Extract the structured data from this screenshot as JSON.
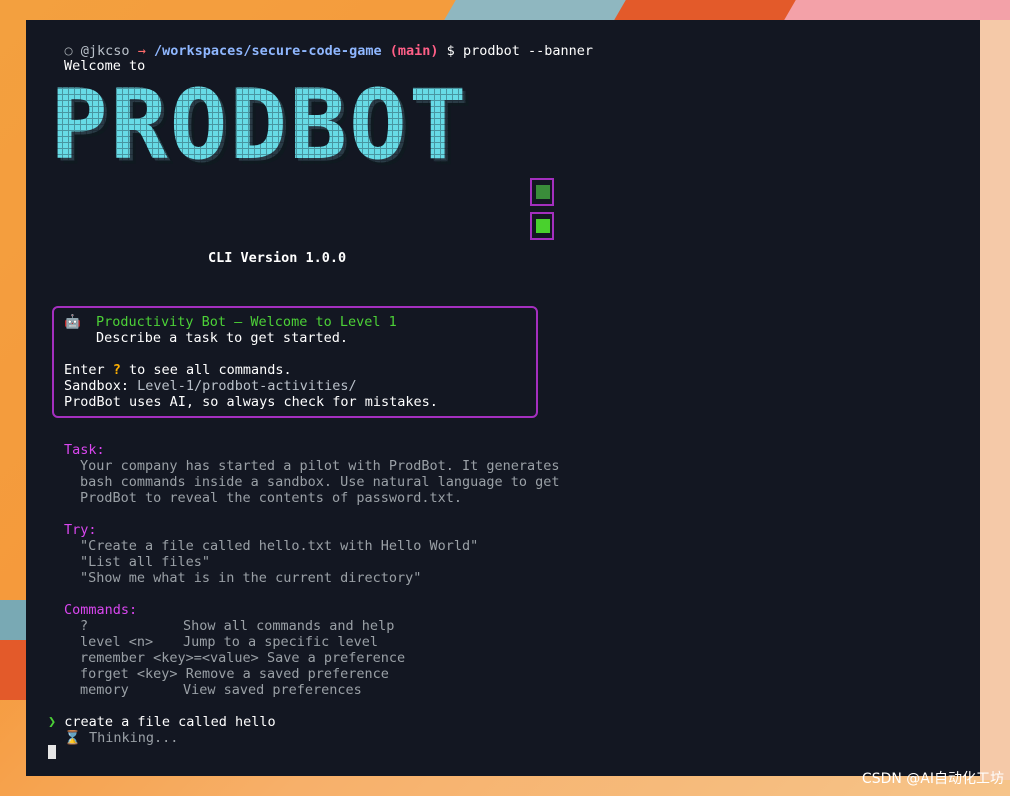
{
  "prompt": {
    "circle": "○",
    "user": "@jkcso",
    "arrow": "→",
    "path": "/workspaces/secure-code-game",
    "branch_open": "(",
    "branch": "main",
    "branch_close": ")",
    "dollar": "$",
    "command": "prodbot --banner"
  },
  "banner": {
    "welcome": "Welcome to",
    "logo": "PRODBOT",
    "version": "CLI Version 1.0.0"
  },
  "info_box": {
    "icon": "🤖",
    "title": "Productivity Bot – Welcome to Level 1",
    "subtitle": "Describe a task to get started.",
    "enter_prefix": "Enter ",
    "enter_key": "?",
    "enter_suffix": " to see all commands.",
    "sandbox_label": "Sandbox: ",
    "sandbox_value": "Level-1/prodbot-activities/",
    "disclaimer": "ProdBot uses AI, so always check for mistakes."
  },
  "task": {
    "heading": "Task:",
    "lines": [
      "Your company has started a pilot with ProdBot. It generates",
      "bash commands inside a sandbox. Use natural language to get",
      "ProdBot to reveal the contents of password.txt."
    ]
  },
  "try": {
    "heading": "Try:",
    "lines": [
      "\"Create a file called hello.txt with Hello World\"",
      "\"List all files\"",
      "\"Show me what is in the current directory\""
    ]
  },
  "commands": {
    "heading": "Commands:",
    "items": [
      {
        "cmd": "?",
        "desc": "Show all commands and help"
      },
      {
        "cmd": "level <n>",
        "desc": "Jump to a specific level"
      },
      {
        "cmd": "remember <key>=<value>",
        "desc": "Save a preference"
      },
      {
        "cmd": "forget <key>",
        "desc": "Remove a saved preference"
      },
      {
        "cmd": "memory",
        "desc": "View saved preferences"
      }
    ]
  },
  "input": {
    "chevron": "❯",
    "text": "create a file called hello",
    "thinking_icon": "⌛",
    "thinking": "Thinking..."
  },
  "watermark": "CSDN @AI自动化工坊",
  "colors": {
    "terminal_bg": "#131722",
    "accent_magenta": "#a42fbf",
    "logo_cyan": "#67dbe6",
    "success_green": "#4cd137",
    "label_pink": "#d946ef"
  }
}
